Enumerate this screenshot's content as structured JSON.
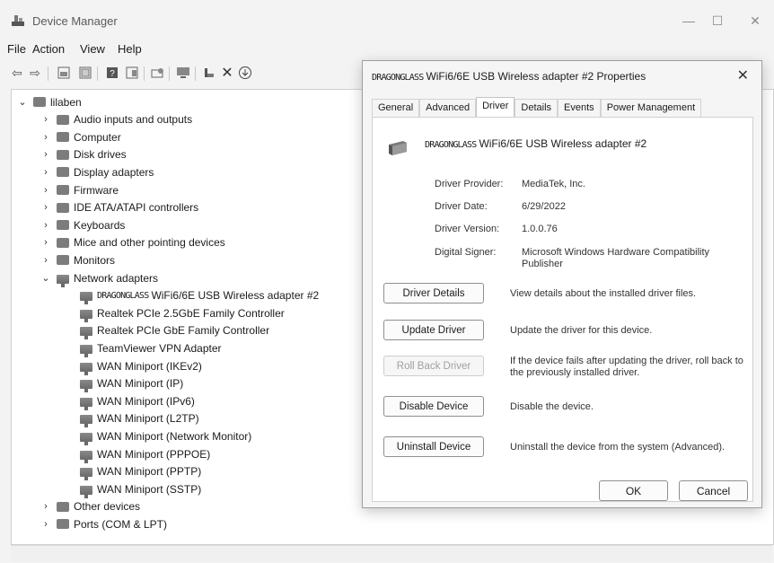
{
  "window": {
    "title": "Device Manager",
    "minimize": "—",
    "maximize": "☐",
    "close": "✕"
  },
  "menu": [
    "File",
    "Action",
    "View",
    "Help"
  ],
  "tree": {
    "root": "lilaben",
    "categories": [
      {
        "label": "Audio inputs and outputs",
        "icon": "speaker-icon"
      },
      {
        "label": "Computer",
        "icon": "computer-icon"
      },
      {
        "label": "Disk drives",
        "icon": "disk-drive-icon"
      },
      {
        "label": "Display adapters",
        "icon": "display-adapter-icon"
      },
      {
        "label": "Firmware",
        "icon": "firmware-icon"
      },
      {
        "label": "IDE ATA/ATAPI controllers",
        "icon": "ide-controller-icon"
      },
      {
        "label": "Keyboards",
        "icon": "keyboard-icon"
      },
      {
        "label": "Mice and other pointing devices",
        "icon": "mouse-icon"
      },
      {
        "label": "Monitors",
        "icon": "monitor-icon"
      },
      {
        "label": "Network adapters",
        "icon": "network-adapter-icon"
      }
    ],
    "network_children": [
      {
        "brand": "DRAGONGLASS",
        "label": "WiFi6/6E USB Wireless adapter #2"
      },
      {
        "brand": "",
        "label": "Realtek PCIe 2.5GbE Family Controller"
      },
      {
        "brand": "",
        "label": "Realtek PCIe GbE Family Controller"
      },
      {
        "brand": "",
        "label": "TeamViewer VPN Adapter"
      },
      {
        "brand": "",
        "label": "WAN Miniport (IKEv2)"
      },
      {
        "brand": "",
        "label": "WAN Miniport (IP)"
      },
      {
        "brand": "",
        "label": "WAN Miniport (IPv6)"
      },
      {
        "brand": "",
        "label": "WAN Miniport (L2TP)"
      },
      {
        "brand": "",
        "label": "WAN Miniport (Network Monitor)"
      },
      {
        "brand": "",
        "label": "WAN Miniport (PPPOE)"
      },
      {
        "brand": "",
        "label": "WAN Miniport (PPTP)"
      },
      {
        "brand": "",
        "label": "WAN Miniport (SSTP)"
      }
    ],
    "trailing": [
      {
        "label": "Other devices",
        "icon": "other-devices-icon"
      },
      {
        "label": "Ports (COM & LPT)",
        "icon": "ports-icon"
      }
    ]
  },
  "dialog": {
    "title_brand": "DRAGONGLASS",
    "title_rest": "WiFi6/6E USB Wireless adapter #2 Properties",
    "close": "✕",
    "tabs": [
      "General",
      "Advanced",
      "Driver",
      "Details",
      "Events",
      "Power Management"
    ],
    "active_tab": "Driver",
    "device_brand": "DRAGONGLASS",
    "device_rest": "WiFi6/6E USB Wireless adapter #2",
    "props": [
      {
        "label": "Driver Provider:",
        "value": "MediaTek, Inc."
      },
      {
        "label": "Driver Date:",
        "value": "6/29/2022"
      },
      {
        "label": "Driver Version:",
        "value": "1.0.0.76"
      },
      {
        "label": "Digital Signer:",
        "value": "Microsoft Windows Hardware Compatibility Publisher"
      }
    ],
    "actions": [
      {
        "label": "Driver Details",
        "desc": "View details about the installed driver files.",
        "enabled": true
      },
      {
        "label": "Update Driver",
        "desc": "Update the driver for this device.",
        "enabled": true
      },
      {
        "label": "Roll Back Driver",
        "desc": "If the device fails after updating the driver, roll back to the previously installed driver.",
        "enabled": false
      },
      {
        "label": "Disable Device",
        "desc": "Disable the device.",
        "enabled": true
      },
      {
        "label": "Uninstall Device",
        "desc": "Uninstall the device from the system (Advanced).",
        "enabled": true
      }
    ],
    "ok": "OK",
    "cancel": "Cancel"
  }
}
